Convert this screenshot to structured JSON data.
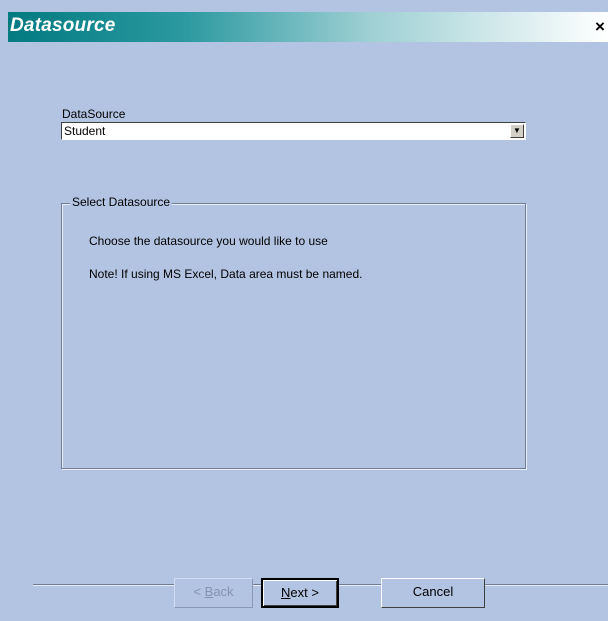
{
  "window": {
    "title": "Datasource",
    "close_glyph": "×"
  },
  "datasource": {
    "label": "DataSource",
    "selected_value": "Student",
    "dropdown_arrow": "▼"
  },
  "group": {
    "legend": "Select Datasource",
    "line1": "Choose the datasource you would like to use",
    "line2": "Note! If using MS Excel, Data area must be named."
  },
  "buttons": {
    "back_prefix": "< ",
    "back_underlined": "B",
    "back_rest": "ack",
    "back_enabled": false,
    "next_underlined": "N",
    "next_rest": "ext >",
    "cancel_label": "Cancel"
  },
  "colors": {
    "dialog_bg": "#b3c3e2",
    "titlebar_start": "#017a80",
    "titlebar_end": "#ffffff",
    "disabled_text": "#8494b2"
  }
}
